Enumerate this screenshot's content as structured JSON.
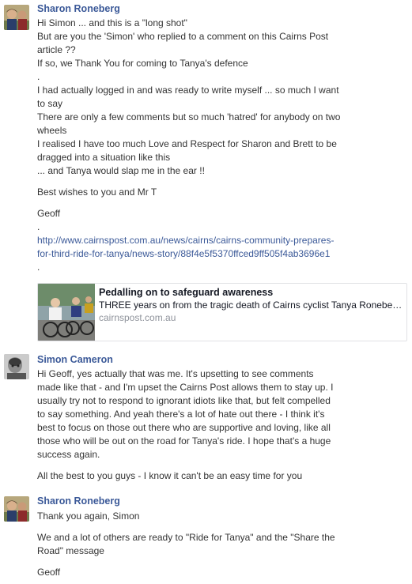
{
  "messages": [
    {
      "author": "Sharon Roneberg",
      "lines": [
        "Hi Simon ... and this is a \"long shot\"",
        "But are you the 'Simon' who replied to a comment on this Cairns Post",
        "article ??",
        "If so, we Thank You for coming to Tanya's defence",
        ".",
        "I had actually logged in and was ready to write myself ... so much I want",
        "to say",
        "There are only a few comments but so much 'hatred' for anybody on two",
        "wheels",
        "I realised I have too much Love and Respect for Sharon and Brett to be",
        "dragged into a situation like this",
        "... and Tanya would slap me in the ear !!"
      ],
      "closing": "Best wishes to you and Mr T",
      "signature": "Geoff",
      "dot_before_link": ".",
      "link_line1": "http://www.cairnspost.com.au/news/cairns/cairns-community-prepares-",
      "link_line2": "for-third-ride-for-tanya/news-story/88f4e5f5370ffced9ff505f4ab3696e1",
      "dot_after_link": ".",
      "preview": {
        "title": "Pedalling on to safeguard awareness",
        "description": "THREE years on from the tragic death of Cairns cyclist Tanya Ronebe…",
        "domain": "cairnspost.com.au"
      }
    },
    {
      "author": "Simon Cameron",
      "lines": [
        "Hi Geoff, yes actually that was me. It's upsetting to see comments",
        "made like that - and I'm upset the Cairns Post allows them to stay up. I",
        "usually try not to respond to ignorant idiots like that, but felt compelled",
        "to say something. And yeah there's a lot of hate out there - I think it's",
        "best to focus on those out there who are supportive and loving, like all",
        "those who will be out on the road for Tanya's ride. I hope that's a huge",
        "success again."
      ],
      "closing": "All the best to you guys - I know it can't be an easy time for you"
    },
    {
      "author": "Sharon Roneberg",
      "lines": [
        "Thank you again, Simon"
      ],
      "para2_line1": "We and a lot of others are ready to \"Ride for Tanya\" and the \"Share the",
      "para2_line2": "Road\" message",
      "signature": "Geoff"
    }
  ],
  "colors": {
    "author": "#3b5998",
    "text": "#333333",
    "link": "#3b5998",
    "domain": "#90949c"
  }
}
